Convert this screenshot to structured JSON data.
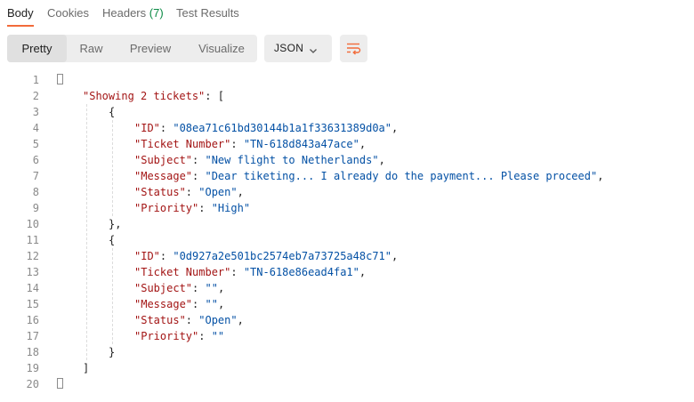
{
  "tabs": [
    {
      "label": "Body"
    },
    {
      "label": "Cookies"
    },
    {
      "label": "Headers",
      "count": "(7)"
    },
    {
      "label": "Test Results"
    }
  ],
  "view_modes": [
    "Pretty",
    "Raw",
    "Preview",
    "Visualize"
  ],
  "format": {
    "label": "JSON"
  },
  "colors": {
    "accent": "#f26b3a",
    "key": "#a31515",
    "string": "#0451a5",
    "count": "#0b8a45"
  },
  "code": {
    "line_numbers": [
      "1",
      "2",
      "3",
      "4",
      "5",
      "6",
      "7",
      "8",
      "9",
      "10",
      "11",
      "12",
      "13",
      "14",
      "15",
      "16",
      "17",
      "18",
      "19",
      "20"
    ],
    "lines": [
      {
        "parts": [
          {
            "t": "p",
            "v": "{"
          }
        ]
      },
      {
        "parts": [
          {
            "t": "k",
            "v": "\"Showing 2 tickets\""
          },
          {
            "t": "p",
            "v": ": ["
          }
        ]
      },
      {
        "parts": [
          {
            "t": "p",
            "v": "{"
          }
        ]
      },
      {
        "parts": [
          {
            "t": "k",
            "v": "\"ID\""
          },
          {
            "t": "p",
            "v": ": "
          },
          {
            "t": "s",
            "v": "\"08ea71c61bd30144b1a1f33631389d0a\""
          },
          {
            "t": "p",
            "v": ","
          }
        ]
      },
      {
        "parts": [
          {
            "t": "k",
            "v": "\"Ticket Number\""
          },
          {
            "t": "p",
            "v": ": "
          },
          {
            "t": "s",
            "v": "\"TN-618d843a47ace\""
          },
          {
            "t": "p",
            "v": ","
          }
        ]
      },
      {
        "parts": [
          {
            "t": "k",
            "v": "\"Subject\""
          },
          {
            "t": "p",
            "v": ": "
          },
          {
            "t": "s",
            "v": "\"New flight to Netherlands\""
          },
          {
            "t": "p",
            "v": ","
          }
        ]
      },
      {
        "parts": [
          {
            "t": "k",
            "v": "\"Message\""
          },
          {
            "t": "p",
            "v": ": "
          },
          {
            "t": "s",
            "v": "\"Dear tiketing... I already do the payment... Please proceed\""
          },
          {
            "t": "p",
            "v": ","
          }
        ]
      },
      {
        "parts": [
          {
            "t": "k",
            "v": "\"Status\""
          },
          {
            "t": "p",
            "v": ": "
          },
          {
            "t": "s",
            "v": "\"Open\""
          },
          {
            "t": "p",
            "v": ","
          }
        ]
      },
      {
        "parts": [
          {
            "t": "k",
            "v": "\"Priority\""
          },
          {
            "t": "p",
            "v": ": "
          },
          {
            "t": "s",
            "v": "\"High\""
          }
        ]
      },
      {
        "parts": [
          {
            "t": "p",
            "v": "},"
          }
        ]
      },
      {
        "parts": [
          {
            "t": "p",
            "v": "{"
          }
        ]
      },
      {
        "parts": [
          {
            "t": "k",
            "v": "\"ID\""
          },
          {
            "t": "p",
            "v": ": "
          },
          {
            "t": "s",
            "v": "\"0d927a2e501bc2574eb7a73725a48c71\""
          },
          {
            "t": "p",
            "v": ","
          }
        ]
      },
      {
        "parts": [
          {
            "t": "k",
            "v": "\"Ticket Number\""
          },
          {
            "t": "p",
            "v": ": "
          },
          {
            "t": "s",
            "v": "\"TN-618e86ead4fa1\""
          },
          {
            "t": "p",
            "v": ","
          }
        ]
      },
      {
        "parts": [
          {
            "t": "k",
            "v": "\"Subject\""
          },
          {
            "t": "p",
            "v": ": "
          },
          {
            "t": "s",
            "v": "\"\""
          },
          {
            "t": "p",
            "v": ","
          }
        ]
      },
      {
        "parts": [
          {
            "t": "k",
            "v": "\"Message\""
          },
          {
            "t": "p",
            "v": ": "
          },
          {
            "t": "s",
            "v": "\"\""
          },
          {
            "t": "p",
            "v": ","
          }
        ]
      },
      {
        "parts": [
          {
            "t": "k",
            "v": "\"Status\""
          },
          {
            "t": "p",
            "v": ": "
          },
          {
            "t": "s",
            "v": "\"Open\""
          },
          {
            "t": "p",
            "v": ","
          }
        ]
      },
      {
        "parts": [
          {
            "t": "k",
            "v": "\"Priority\""
          },
          {
            "t": "p",
            "v": ": "
          },
          {
            "t": "s",
            "v": "\"\""
          }
        ]
      },
      {
        "parts": [
          {
            "t": "p",
            "v": "}"
          }
        ]
      },
      {
        "parts": [
          {
            "t": "p",
            "v": "]"
          }
        ]
      },
      {
        "parts": [
          {
            "t": "p",
            "v": "}"
          }
        ]
      }
    ]
  }
}
